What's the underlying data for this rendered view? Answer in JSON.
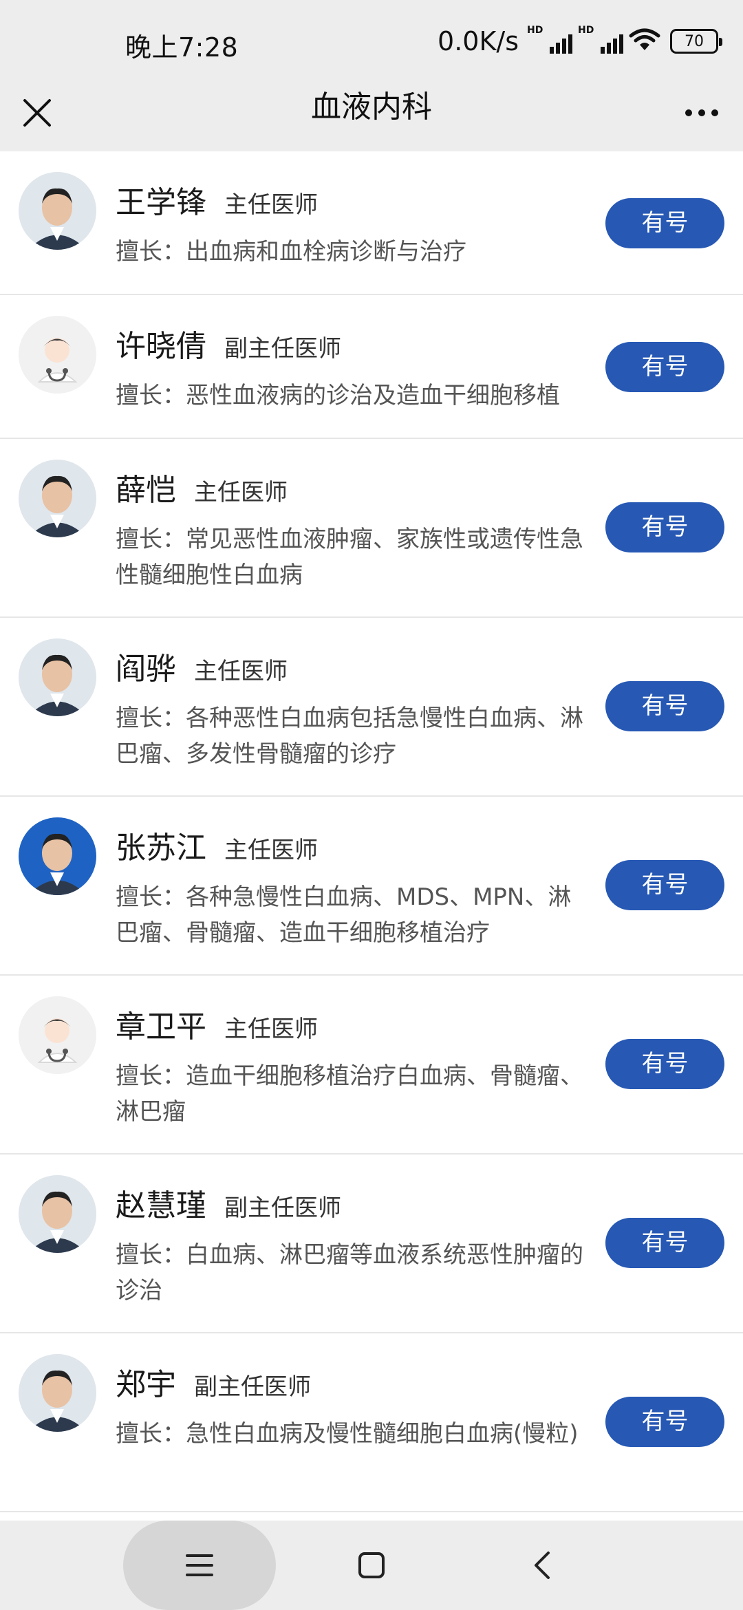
{
  "status_bar": {
    "time": "晚上7:28",
    "net_speed": "0.0K/s",
    "signal_badge": "HD",
    "battery": "70"
  },
  "header": {
    "title": "血液内科",
    "close_icon": "close-icon",
    "more_icon": "more-icon"
  },
  "doctors": [
    {
      "name": "王学锋",
      "title": "主任医师",
      "specialty": "擅长：出血病和血栓病诊断与治疗",
      "button": "有号",
      "avatar": "photo"
    },
    {
      "name": "许晓倩",
      "title": "副主任医师",
      "specialty": "擅长：恶性血液病的诊治及造血干细胞移植",
      "button": "有号",
      "avatar": "placeholder"
    },
    {
      "name": "薛恺",
      "title": "主任医师",
      "specialty": "擅长：常见恶性血液肿瘤、家族性或遗传性急性髓细胞性白血病",
      "button": "有号",
      "avatar": "photo"
    },
    {
      "name": "阎骅",
      "title": "主任医师",
      "specialty": "擅长：各种恶性白血病包括急慢性白血病、淋巴瘤、多发性骨髓瘤的诊疗",
      "button": "有号",
      "avatar": "photo"
    },
    {
      "name": "张苏江",
      "title": "主任医师",
      "specialty": "擅长：各种急慢性白血病、MDS、MPN、淋巴瘤、骨髓瘤、造血干细胞移植治疗",
      "button": "有号",
      "avatar": "photo-blue"
    },
    {
      "name": "章卫平",
      "title": "主任医师",
      "specialty": "擅长：造血干细胞移植治疗白血病、骨髓瘤、淋巴瘤",
      "button": "有号",
      "avatar": "placeholder"
    },
    {
      "name": "赵慧瑾",
      "title": "副主任医师",
      "specialty": "擅长：白血病、淋巴瘤等血液系统恶性肿瘤的诊治",
      "button": "有号",
      "avatar": "photo"
    },
    {
      "name": "郑宇",
      "title": "副主任医师",
      "specialty": "擅长：急性白血病及慢性髓细胞白血病(慢粒)",
      "button": "有号",
      "avatar": "photo"
    }
  ],
  "nav": {
    "menu_icon": "menu-icon",
    "home_icon": "home-icon",
    "back_icon": "back-icon"
  },
  "colors": {
    "accent": "#2658b4",
    "header_bg": "#ededed"
  }
}
